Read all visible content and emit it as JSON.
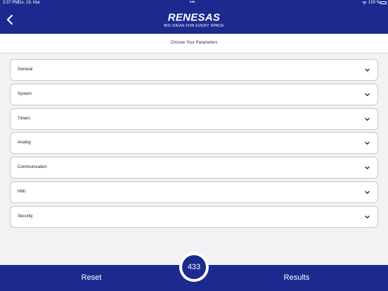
{
  "status_bar": {
    "time": "3:37 PM",
    "date": "Do. 19. Mai",
    "dots": "•••",
    "battery": "100 %"
  },
  "header": {
    "back_icon": "chevron-left-icon",
    "logo_text": "RENESAS",
    "tagline": "BIG IDEAS FOR EVERY SPACE"
  },
  "subheader": {
    "title": "Choose Your Parameters"
  },
  "parameters": [
    {
      "label": "General"
    },
    {
      "label": "System"
    },
    {
      "label": "Timers"
    },
    {
      "label": "Analog"
    },
    {
      "label": "Communication"
    },
    {
      "label": "HMI"
    },
    {
      "label": "Security"
    }
  ],
  "footer": {
    "reset_label": "Reset",
    "results_label": "Results",
    "count": "433"
  },
  "colors": {
    "brand": "#1c2a8f",
    "background": "#f2f2f4"
  }
}
